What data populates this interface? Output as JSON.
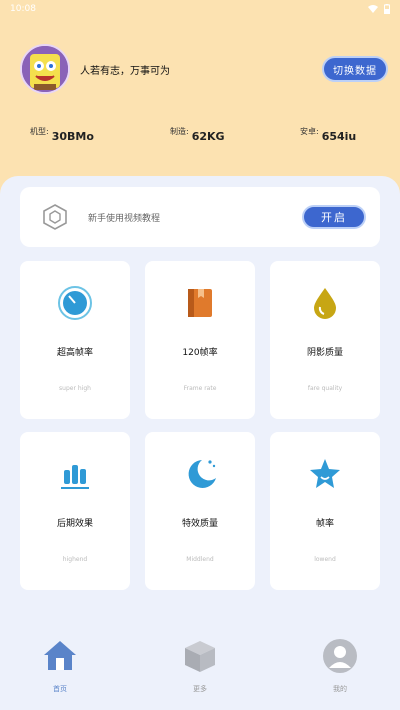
{
  "status_bar": {
    "time": "10:08"
  },
  "profile": {
    "slogan": "人若有志，万事可为",
    "switch_button": "切换数据"
  },
  "specs": [
    {
      "key": "机型:",
      "value": "30BMo"
    },
    {
      "key": "制造:",
      "value": "62KG"
    },
    {
      "key": "安卓:",
      "value": "654iu"
    }
  ],
  "tutorial": {
    "label": "新手使用视频教程",
    "open_button": "开启"
  },
  "cards": [
    {
      "title": "超高帧率",
      "subtitle": "super high",
      "icon": "stopwatch-icon"
    },
    {
      "title": "120帧率",
      "subtitle": "Frame rate",
      "icon": "book-icon"
    },
    {
      "title": "阴影质量",
      "subtitle": "fare quality",
      "icon": "drop-icon"
    },
    {
      "title": "后期效果",
      "subtitle": "highend",
      "icon": "bar-chart-icon"
    },
    {
      "title": "特效质量",
      "subtitle": "Middlend",
      "icon": "moon-icon"
    },
    {
      "title": "帧率",
      "subtitle": "lowend",
      "icon": "star-icon"
    }
  ],
  "nav": [
    {
      "label": "首页",
      "icon": "home-icon",
      "active": true
    },
    {
      "label": "更多",
      "icon": "cube-icon",
      "active": false
    },
    {
      "label": "我的",
      "icon": "user-icon",
      "active": false
    }
  ],
  "colors": {
    "background": "#fce2b1",
    "panel": "#edf1fb",
    "accent": "#3d67cf"
  }
}
